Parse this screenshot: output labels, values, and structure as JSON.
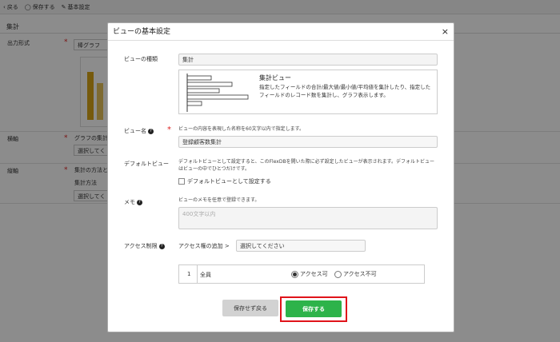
{
  "toolbar": {
    "back_label": "戻る",
    "save_label": "保存する",
    "settings_label": "基本設定"
  },
  "background": {
    "section_title": "集計",
    "row1_label": "出力形式",
    "row1_value": "棒グラフ",
    "row2_label": "横軸",
    "row2_desc": "グラフの集計",
    "row2_select": "選択してく",
    "row3_label": "縦軸",
    "row3_desc": "集計の方法と",
    "row3_method": "集計方法",
    "row3_select": "選択してく",
    "required_mark": "*"
  },
  "modal": {
    "title": "ビューの基本設定",
    "close_icon": "×",
    "view_type_label": "ビューの種類",
    "view_type_value": "集計",
    "preview_title": "集計ビュー",
    "preview_desc": "指定したフィールドの合計/最大値/最小値/平均値を集計したり、指定したフィールドのレコード数を集計し、グラフ表示します。",
    "view_name_label": "ビュー名",
    "view_name_hint": "ビューの内容を表現した名称を60文字以内で指定します。",
    "view_name_value": "登録顧客数集計",
    "default_label": "デフォルトビュー",
    "default_hint": "デフォルトビューとして設定すると、このFlexDBを開いた際に必ず設定したビューが表示されます。デフォルトビューはビューの中でひとつだけです。",
    "default_checkbox_label": "デフォルトビューとして設定する",
    "memo_label": "メモ",
    "memo_hint": "ビューのメモを任意で登録できます。",
    "memo_placeholder": "400文字以内",
    "access_label": "アクセス制限",
    "access_add_label": "アクセス権の追加 >",
    "access_select": "選択してください",
    "access_row_num": "1",
    "access_row_name": "全員",
    "access_allow": "アクセス可",
    "access_deny": "アクセス不可",
    "cancel_button": "保存せず戻る",
    "save_button": "保存する",
    "required_mark": "*"
  },
  "colors": {
    "save_green": "#2db34a",
    "highlight_red": "#e0131a",
    "required_red": "#dd2222",
    "bar_gold": "#d8a417"
  }
}
